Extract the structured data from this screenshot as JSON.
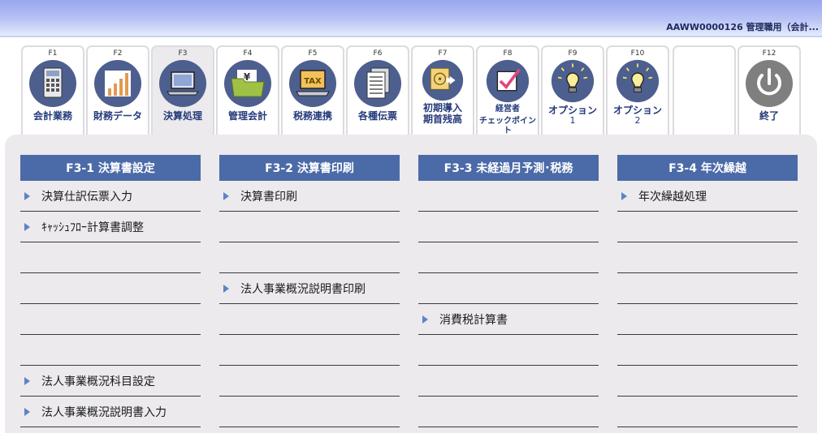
{
  "header": {
    "user_info": "AAWW0000126 管理職用（会計..."
  },
  "fkeys": [
    {
      "code": "F1",
      "label": "会計業務",
      "sub": "",
      "icon": "calculator-icon"
    },
    {
      "code": "F2",
      "label": "財務データ",
      "sub": "",
      "icon": "bar-chart-icon"
    },
    {
      "code": "F3",
      "label": "決算処理",
      "sub": "",
      "icon": "laptop-icon"
    },
    {
      "code": "F4",
      "label": "管理会計",
      "sub": "",
      "icon": "yen-folder-icon"
    },
    {
      "code": "F5",
      "label": "税務連携",
      "sub": "",
      "icon": "tax-laptop-icon"
    },
    {
      "code": "F6",
      "label": "各種伝票",
      "sub": "",
      "icon": "documents-icon"
    },
    {
      "code": "F7",
      "label": "初期導入",
      "sub": "期首残高",
      "icon": "disc-export-icon"
    },
    {
      "code": "F8",
      "label": "経営者",
      "sub": "チェックポイント",
      "icon": "checkbox-icon"
    },
    {
      "code": "F9",
      "label": "オプション",
      "sub": "1",
      "icon": "lightbulb-icon"
    },
    {
      "code": "F10",
      "label": "オプション",
      "sub": "2",
      "icon": "lightbulb-icon"
    },
    {
      "code": "",
      "label": "",
      "sub": "",
      "icon": ""
    },
    {
      "code": "F12",
      "label": "終了",
      "sub": "",
      "icon": "power-icon"
    }
  ],
  "columns": [
    {
      "title": "F3-1 決算書設定",
      "rows": [
        "決算仕訳伝票入力",
        "ｷｬｯｼｭﾌﾛｰ計算書調整",
        "",
        "",
        "",
        "",
        "法人事業概況科目設定",
        "法人事業概況説明書入力"
      ]
    },
    {
      "title": "F3-2 決算書印刷",
      "rows": [
        "決算書印刷",
        "",
        "",
        "法人事業概況説明書印刷",
        "",
        "",
        "",
        ""
      ]
    },
    {
      "title": "F3-3 未経過月予測･税務",
      "rows": [
        "",
        "",
        "",
        "",
        "消費税計算書",
        "",
        "",
        ""
      ]
    },
    {
      "title": "F3-4 年次繰越",
      "rows": [
        "年次繰越処理",
        "",
        "",
        "",
        "",
        "",
        "",
        ""
      ]
    }
  ],
  "colors": {
    "header_blue": "#4b6aa8",
    "panel_bg": "#eceaed",
    "icon_circle": "#4d5f8e",
    "label_text": "#243a7a"
  }
}
